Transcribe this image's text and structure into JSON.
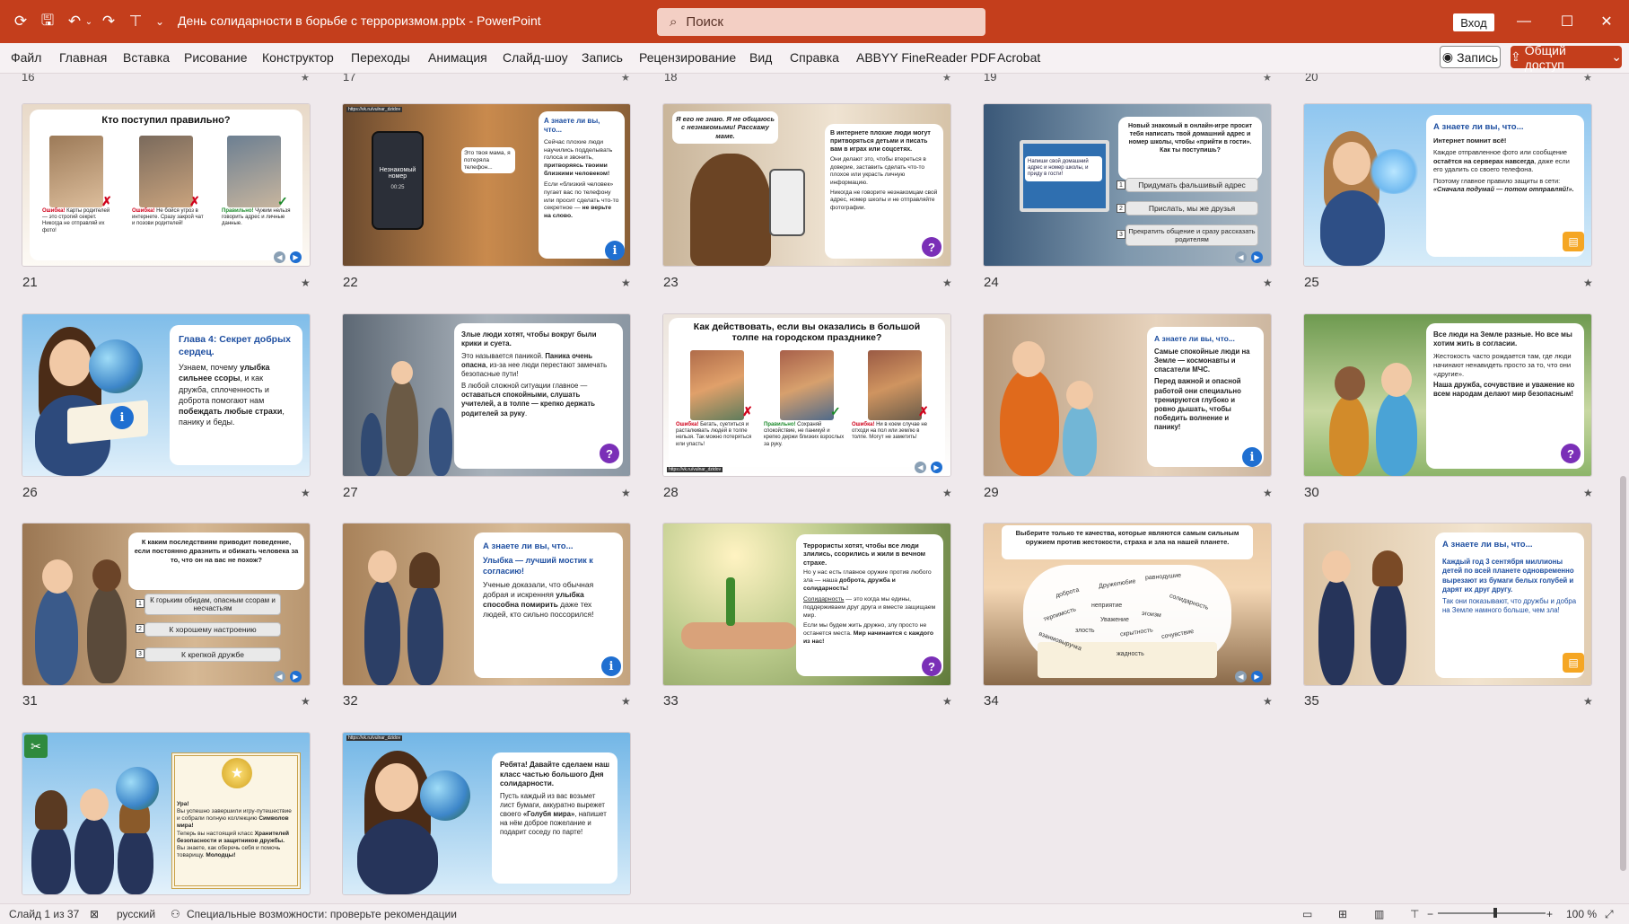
{
  "titlebar": {
    "document_title": "День солидарности в борьбе с терроризмом.pptx  -  PowerPoint",
    "search_placeholder": "Поиск",
    "signin_label": "Вход"
  },
  "menu": [
    "Файл",
    "Главная",
    "Вставка",
    "Рисование",
    "Конструктор",
    "Переходы",
    "Анимация",
    "Слайд-шоу",
    "Запись",
    "Рецензирование",
    "Вид",
    "Справка",
    "ABBYY FineReader PDF",
    "Acrobat"
  ],
  "record_button": "Запись",
  "share_button": "Общий доступ",
  "top_numbers": [
    "16",
    "17",
    "18",
    "19",
    "20"
  ],
  "slides": {
    "s21": {
      "num": "21",
      "title": "Кто поступил правильно?",
      "c1": "Ошибка!",
      "c1t": " Карты родителей — это строгий секрет. Никогда не отправляй их фото!",
      "c2": "Ошибка!",
      "c2t": " Не бойся угроз в интернете. Сразу закрой чат и позови родителей!",
      "c3": "Правильно!",
      "c3t": " Чужим нельзя говорить адрес и личные данные."
    },
    "s22": {
      "num": "22",
      "url": "https://vk.ru/vulnar_dzidov",
      "bubble": "Это твоя мама, я потеряла телефон...",
      "phone": "Незнакомый номер",
      "phone_sub": "00:25",
      "heading": "А знаете ли вы, что...",
      "p1a": "Сейчас плохие люди научились подделывать голоса и звонить, ",
      "p1b": "притворяясь твоими близкими человеком!",
      "p2": "Если «близкий человек» пугает вас по телефону или просит сделать что-то секретное — ",
      "p2b": "не верьте на слово."
    },
    "s23": {
      "num": "23",
      "bubble": "Я его не знаю. Я не общаюсь с незнакомыми! Расскажу маме.",
      "p1": "В интернете плохие люди могут притворяться детьми и писать вам в играх или соцсетях.",
      "p2": "Они делают это, чтобы втереться в доверие, заставить сделать что-то плохое или украсть личную информацию.",
      "p3": "Никогда не говорите незнакомцам свой адрес, номер школы и не отправляйте фотографии."
    },
    "s24": {
      "num": "24",
      "screen": "Напиши свой домашний адрес и номер школы, и приду в гости!",
      "question": "Новый знакомый в онлайн-игре просит тебя написать твой домашний адрес и номер школы, чтобы «прийти в гости». Как ты поступишь?",
      "o1": "Придумать фальшивый адрес",
      "o2": "Прислать, мы же друзья",
      "o3": "Прекратить общение и сразу рассказать родителям"
    },
    "s25": {
      "num": "25",
      "heading": "А знаете ли вы, что...",
      "p1": "Интернет помнит всё!",
      "p2": "Каждое отправленное фото или сообщение ",
      "p2b": "остаётся на серверах навсегда",
      "p2c": ", даже если его удалить со своего телефона.",
      "p3": "Поэтому главное правило защиты в сети: ",
      "p3b": "«Сначала подумай — потом отправляй!»."
    },
    "s26": {
      "num": "26",
      "heading": "Глава 4: Секрет добрых сердец.",
      "p1": "Узнаем, почему ",
      "p1b": "улыбка сильнее ссоры",
      "p1c": ", и как дружба, сплоченность и доброта помогают нам ",
      "p1d": "побеждать любые страхи",
      "p1e": ", панику и беды."
    },
    "s27": {
      "num": "27",
      "p1": "Злые люди хотят, чтобы вокруг были крики и суета.",
      "p2": "Это называется паникой. ",
      "p2b": "Паника очень опасна",
      "p2c": ", из-за нее люди перестают замечать безопасные пути!",
      "p3": "В любой сложной ситуации главное — ",
      "p3b": "оставаться спокойными, слушать учителей, а в толпе — крепко держать родителей за руку",
      "p3c": "."
    },
    "s28": {
      "num": "28",
      "title": "Как действовать, если вы оказались в большой толпе на городском празднике?",
      "c1": "Ошибка!",
      "c1t": " Бегать, суетиться и расталкивать людей в толпе нельзя. Так можно потеряться или упасть!",
      "c2": "Правильно!",
      "c2t": " Сохраняй спокойствие, не паникуй и крепко держи близких взрослых за руку.",
      "c3": "Ошибка!",
      "c3t": " Ни в коем случае не отходи на пол или землю в толпе. Могут не заметить!",
      "url": "https://vk.ru/vulnar_dzidov"
    },
    "s29": {
      "num": "29",
      "heading": "А знаете ли вы, что...",
      "p1": "Самые спокойные люди на Земле — космонавты и спасатели МЧС.",
      "p2": "Перед важной и опасной работой они специально тренируются глубоко и ровно дышать, чтобы победить волнение и панику!"
    },
    "s30": {
      "num": "30",
      "p1": "Все люди на Земле разные. Но все мы хотим жить в согласии.",
      "p2": "Жестокость часто рождается там, где люди начинают ненавидеть просто за то, что они «другие».",
      "p3": "Наша дружба, сочувствие и уважение ко всем народам делают мир безопасным!"
    },
    "s31": {
      "num": "31",
      "question": "К каким последствиям приводит поведение, если постоянно дразнить и обижать человека за то, что он на вас не похож?",
      "o1": "К горьким обидам, опасным ссорам и несчастьям",
      "o2": "К хорошему настроению",
      "o3": "К крепкой дружбе"
    },
    "s32": {
      "num": "32",
      "heading": "А знаете ли вы, что...",
      "p1": "Улыбка — лучший мостик к согласию!",
      "p2": "Ученые доказали, что обычная добрая и искренняя ",
      "p2b": "улыбка способна помирить",
      "p2c": " даже тех людей, кто сильно поссорился!"
    },
    "s33": {
      "num": "33",
      "p1": "Террористы хотят, чтобы все люди злились, ссорились и жили в вечном страхе.",
      "p2": "Но у нас есть главное оружие против любого зла — наша ",
      "p2b": "доброта, дружба и солидарность!",
      "p3a": "Солидарность",
      "p3": " — это когда мы едины, поддерживаем друг друга и вместе защищаем мир.",
      "p4": "Если мы будем жить дружно, злу просто не останется места. ",
      "p4b": "Мир начинается с каждого из нас!"
    },
    "s34": {
      "num": "34",
      "title": "Выберите только те качества, которые являются самым сильным оружием против жестокости, страха и зла на нашей планете.",
      "w1": "доброта",
      "w2": "Дружелюбие",
      "w3": "равнодушие",
      "w4": "терпимость",
      "w5": "неприятие",
      "w6": "солидарность",
      "w7": "Уважение",
      "w8": "эгоизм",
      "w9": "злость",
      "w10": "скрытность",
      "w11": "сочувствие",
      "w12": "взаимовыручка",
      "w13": "жадность"
    },
    "s35": {
      "num": "35",
      "heading": "А знаете ли вы, что...",
      "p1": "Каждый год 3 сентября миллионы детей по всей планете одновременно вырезают из бумаги белых голубей и дарят их друг другу.",
      "p2": "Так они показывают, что дружбы и добра на Земле намного больше, чем зла!"
    },
    "s36": {
      "p0": "Ура!",
      "p1": "Вы успешно завершили игру-путешествие и собрали полную коллекцию ",
      "p1b": "Символов мира!",
      "p2": "Теперь вы настоящий класс ",
      "p2b": "Хранителей безопасности и защитников дружбы.",
      "p3": "Вы знаете, как оберечь себя и помочь товарищу. ",
      "p3b": "Молодцы!"
    },
    "s37": {
      "url": "https://vk.ru/vulnar_dzidov",
      "p1": "Ребята! Давайте сделаем наш класс ",
      "p1b": "частью большого Дня солидарности.",
      "p2": "Пусть каждый из вас возьмет лист бумаги, аккуратно вырежет своего ",
      "p2b": "«Голубя мира»",
      "p2c": ", напишет на нём доброе пожелание и подарит соседу по парте!"
    }
  },
  "statusbar": {
    "slide_info": "Слайд 1 из 37",
    "language": "русский",
    "accessibility": "Специальные возможности: проверьте рекомендации",
    "zoom": "100 %"
  },
  "colors": {
    "accent": "#c43e1c",
    "info": "#1f6fd1",
    "question": "#7a2fb7",
    "heading": "#1d4ea0"
  }
}
